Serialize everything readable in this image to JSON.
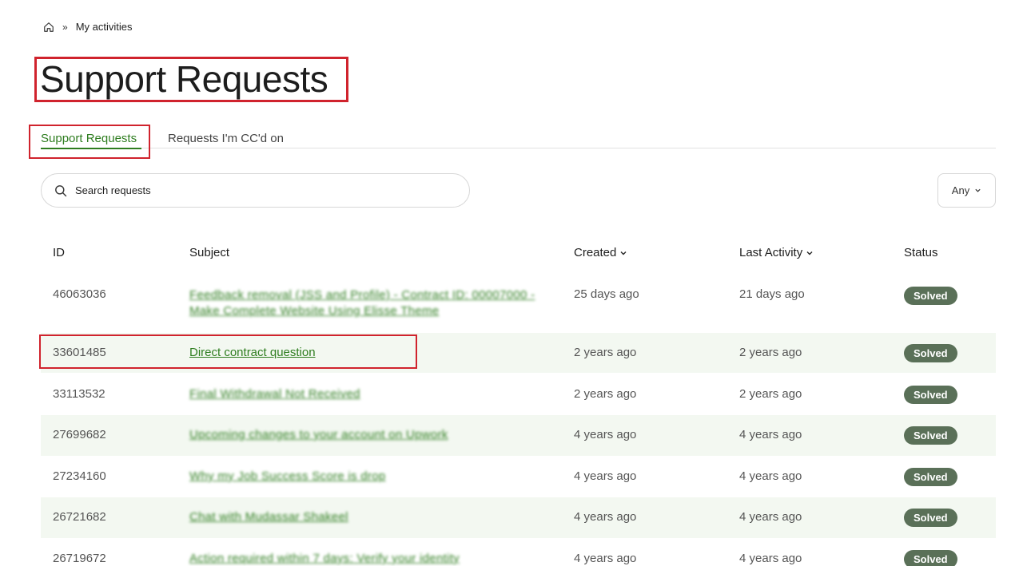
{
  "breadcrumb": {
    "home_icon": "home-icon",
    "separator": "»",
    "current": "My activities"
  },
  "page": {
    "title": "Support Requests"
  },
  "tabs": [
    {
      "label": "Support Requests",
      "active": true
    },
    {
      "label": "Requests I'm CC'd on",
      "active": false
    }
  ],
  "search": {
    "placeholder": "Search requests",
    "icon": "search-icon"
  },
  "filter": {
    "value": "Any"
  },
  "table": {
    "headers": {
      "id": "ID",
      "subject": "Subject",
      "created": "Created",
      "last_activity": "Last Activity",
      "status": "Status"
    },
    "rows": [
      {
        "id": "46063036",
        "subject": "Feedback removal (JSS and Profile) - Contract ID: 00007000 -",
        "subject2": "Make Complete Website Using Elisse Theme",
        "created": "25 days ago",
        "last": "21 days ago",
        "status": "Solved"
      },
      {
        "id": "33601485",
        "subject": "Direct contract question",
        "created": "2 years ago",
        "last": "2 years ago",
        "status": "Solved"
      },
      {
        "id": "33113532",
        "subject": "Final Withdrawal Not Received",
        "created": "2 years ago",
        "last": "2 years ago",
        "status": "Solved"
      },
      {
        "id": "27699682",
        "subject": "Upcoming changes to your account on Upwork",
        "created": "4 years ago",
        "last": "4 years ago",
        "status": "Solved"
      },
      {
        "id": "27234160",
        "subject": "Why my Job Success Score is drop",
        "created": "4 years ago",
        "last": "4 years ago",
        "status": "Solved"
      },
      {
        "id": "26721682",
        "subject": "Chat with Mudassar Shakeel",
        "created": "4 years ago",
        "last": "4 years ago",
        "status": "Solved"
      },
      {
        "id": "26719672",
        "subject": "Action required within 7 days: Verify your identity",
        "created": "4 years ago",
        "last": "4 years ago",
        "status": "Solved"
      }
    ]
  },
  "colors": {
    "accent": "#2e7d1f",
    "highlight_box": "#d0232d",
    "badge": "#5a7058",
    "row_alt": "#f3f8f1"
  }
}
